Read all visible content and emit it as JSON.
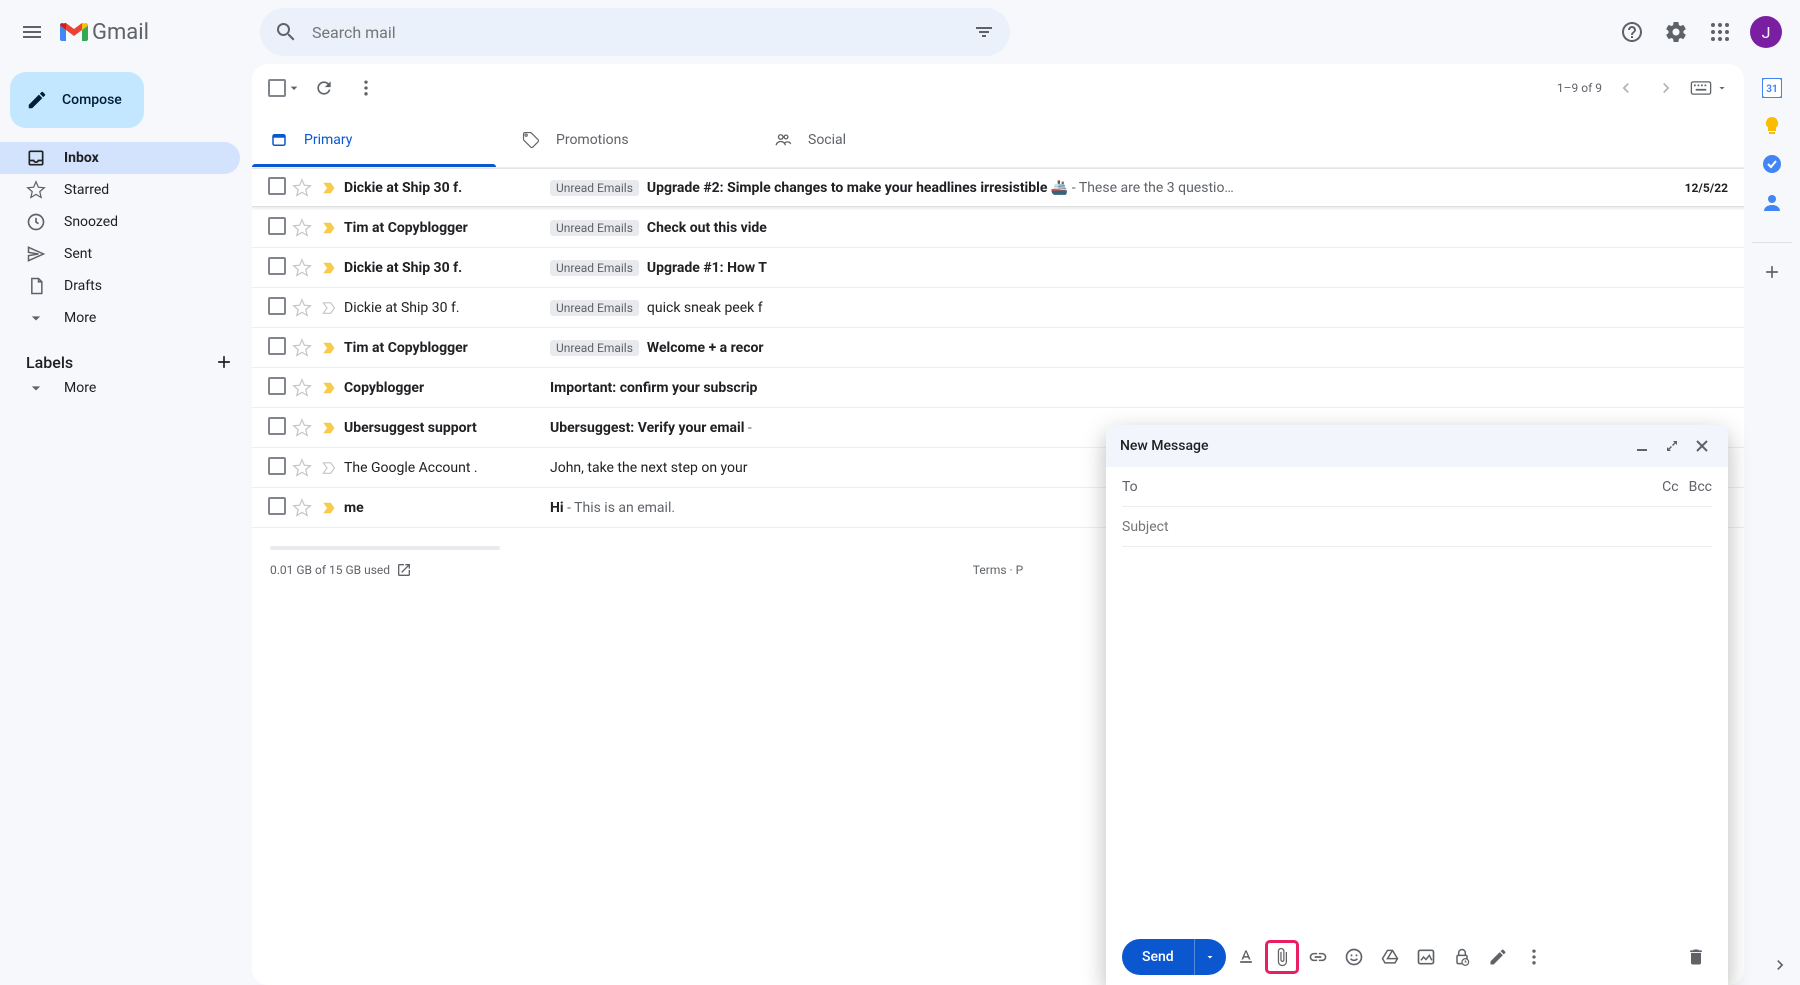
{
  "header": {
    "logo_text": "Gmail",
    "search_placeholder": "Search mail",
    "avatar_initial": "J"
  },
  "compose_button": "Compose",
  "nav": [
    {
      "icon": "inbox",
      "label": "Inbox",
      "active": true
    },
    {
      "icon": "star",
      "label": "Starred"
    },
    {
      "icon": "clock",
      "label": "Snoozed"
    },
    {
      "icon": "send",
      "label": "Sent"
    },
    {
      "icon": "file",
      "label": "Drafts"
    },
    {
      "icon": "chev",
      "label": "More"
    }
  ],
  "labels_header": "Labels",
  "labels_more": "More",
  "toolbar": {
    "page_text": "1–9 of 9"
  },
  "tabs": [
    {
      "label": "Primary",
      "active": true
    },
    {
      "label": "Promotions"
    },
    {
      "label": "Social"
    }
  ],
  "label_chip": "Unread Emails",
  "rows": [
    {
      "unread": true,
      "imp": "y",
      "sender": "Dickie at Ship 30 f.",
      "has_label": true,
      "subject": "Upgrade #2: Simple changes to make your headlines irresistible 🚢",
      "snippet": " - These are the 3 questio…",
      "date": "12/5/22"
    },
    {
      "unread": true,
      "imp": "y",
      "sender": "Tim at Copyblogger",
      "has_label": true,
      "subject": "Check out this vide",
      "snippet": "",
      "date": ""
    },
    {
      "unread": true,
      "imp": "y",
      "sender": "Dickie at Ship 30 f.",
      "has_label": true,
      "subject": "Upgrade #1: How T",
      "snippet": "",
      "date": ""
    },
    {
      "unread": false,
      "imp": "g",
      "sender": "Dickie at Ship 30 f.",
      "has_label": true,
      "subject": "quick sneak peek f",
      "snippet": "",
      "date": ""
    },
    {
      "unread": true,
      "imp": "y",
      "sender": "Tim at Copyblogger",
      "has_label": true,
      "subject": "Welcome + a recor",
      "snippet": "",
      "date": ""
    },
    {
      "unread": true,
      "imp": "y",
      "sender": "Copyblogger",
      "has_label": false,
      "subject": "Important: confirm your subscrip",
      "snippet": "",
      "date": ""
    },
    {
      "unread": true,
      "imp": "y",
      "sender": "Ubersuggest support",
      "has_label": false,
      "subject": "Ubersuggest: Verify your email",
      "snippet": " - ",
      "date": ""
    },
    {
      "unread": false,
      "imp": "g",
      "sender": "The Google Account .",
      "has_label": false,
      "subject": "John, take the next step on your",
      "snippet": "",
      "date": ""
    },
    {
      "unread": true,
      "imp": "y",
      "sender": "me",
      "has_label": false,
      "subject": "Hi",
      "snippet": " - This is an email.",
      "date": ""
    }
  ],
  "footer": {
    "storage": "0.01 GB of 15 GB used",
    "terms": "Terms · P"
  },
  "compose": {
    "title": "New Message",
    "to_label": "To",
    "cc": "Cc",
    "bcc": "Bcc",
    "subject_placeholder": "Subject",
    "send": "Send"
  }
}
